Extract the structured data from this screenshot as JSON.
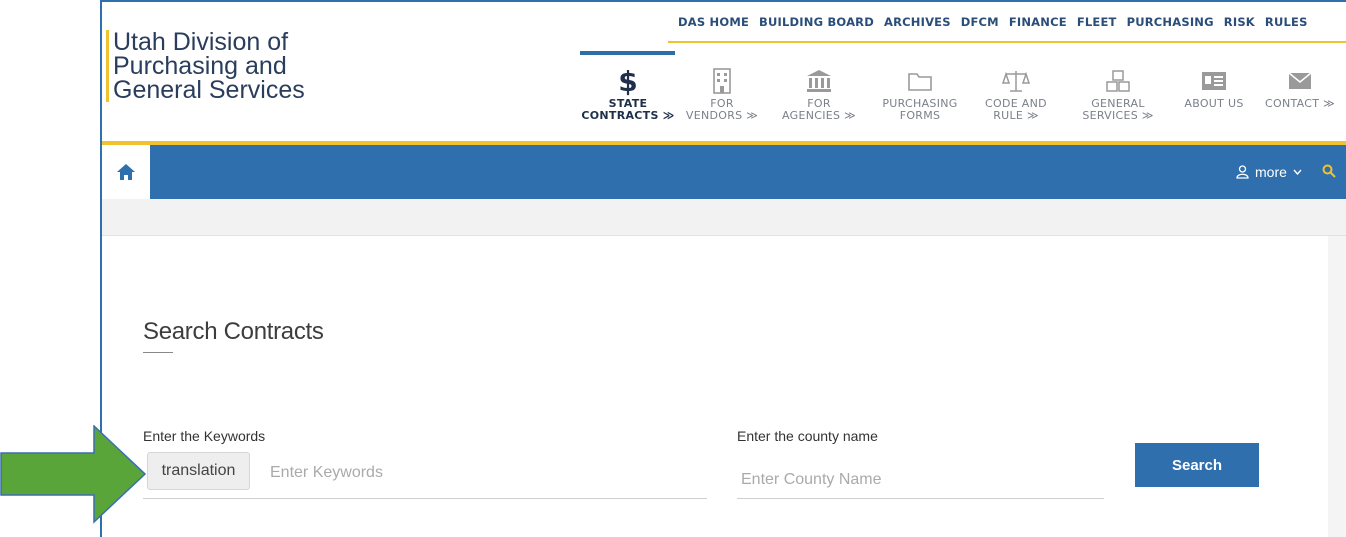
{
  "logo": {
    "line1": "Utah Division of",
    "line2": "Purchasing and",
    "line3": "General Services"
  },
  "util_links": [
    "DAS HOME",
    "BUILDING BOARD",
    "ARCHIVES",
    "DFCM",
    "FINANCE",
    "FLEET",
    "PURCHASING",
    "RISK",
    "RULES"
  ],
  "nav": [
    {
      "line1": "STATE",
      "line2": "CONTRACTS ≫",
      "icon": "dollar-icon"
    },
    {
      "line1": "FOR",
      "line2": "VENDORS ≫",
      "icon": "building-icon"
    },
    {
      "line1": "FOR",
      "line2": "AGENCIES ≫",
      "icon": "bank-icon"
    },
    {
      "line1": "PURCHASING",
      "line2": "FORMS",
      "icon": "folder-icon"
    },
    {
      "line1": "CODE AND",
      "line2": "RULE ≫",
      "icon": "scales-icon"
    },
    {
      "line1": "GENERAL",
      "line2": "SERVICES ≫",
      "icon": "cubes-icon"
    },
    {
      "line1": "ABOUT US",
      "line2": "",
      "icon": "id-card-icon"
    },
    {
      "line1": "CONTACT ≫",
      "line2": "",
      "icon": "envelope-icon"
    }
  ],
  "bar": {
    "more_label": "more"
  },
  "search": {
    "title": "Search Contracts",
    "keyword_label": "Enter the Keywords",
    "keyword_chip": "translation",
    "keyword_placeholder": "Enter Keywords",
    "county_label": "Enter the county name",
    "county_placeholder": "Enter County Name",
    "button_label": "Search"
  },
  "colors": {
    "brand_blue": "#2f6fad",
    "gold": "#f2c12e",
    "arrow_green": "#5aa53a"
  }
}
